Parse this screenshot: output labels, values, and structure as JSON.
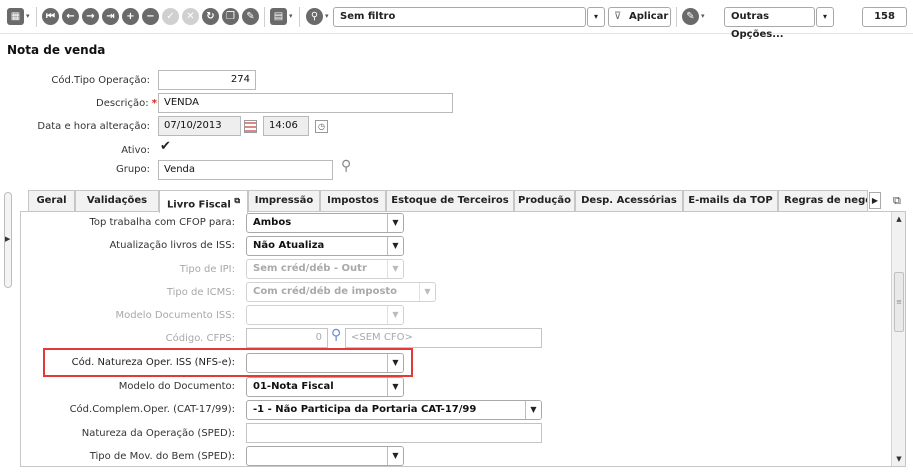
{
  "toolbar": {
    "filter_value": "Sem filtro",
    "apply_label": "Aplicar",
    "more_options_label": "Outras Opções...",
    "count": "158"
  },
  "header": {
    "title": "Nota de venda",
    "cod_tipo_label": "Cód.Tipo Operação:",
    "cod_tipo_value": "274",
    "descricao_label": "Descrição:",
    "descricao_required": "*",
    "descricao_value": "VENDA",
    "data_label": "Data e hora alteração:",
    "data_value": "07/10/2013",
    "hora_value": "14:06",
    "ativo_label": "Ativo:",
    "grupo_label": "Grupo:",
    "grupo_value": "Venda"
  },
  "tabs": [
    {
      "label": "Geral"
    },
    {
      "label": "Validações"
    },
    {
      "label": "Livro Fiscal"
    },
    {
      "label": "Impressão"
    },
    {
      "label": "Impostos"
    },
    {
      "label": "Estoque de Terceiros"
    },
    {
      "label": "Produção"
    },
    {
      "label": "Desp. Acessórias"
    },
    {
      "label": "E-mails da TOP"
    },
    {
      "label": "Regras de negócio"
    }
  ],
  "fields": {
    "cfop_label": "Top trabalha com CFOP para:",
    "cfop_value": "Ambos",
    "iss_label": "Atualização livros de ISS:",
    "iss_value": "Não Atualiza",
    "ipi_label": "Tipo de IPI:",
    "ipi_value": "Sem créd/déb - Outr",
    "icms_label": "Tipo de ICMS:",
    "icms_value": "Com créd/déb de imposto",
    "modelo_iss_label": "Modelo Documento ISS:",
    "cfps_label": "Código. CFPS:",
    "cfps_value": "0",
    "cfps_desc": "<SEM CFO>",
    "natureza_iss_label": "Cód. Natureza Oper. ISS (NFS-e):",
    "modelo_doc_label": "Modelo do Documento:",
    "modelo_doc_value": "01-Nota Fiscal",
    "complem_label": "Cód.Complem.Oper. (CAT-17/99):",
    "complem_value": "-1 - Não Participa da Portaria CAT-17/99",
    "natureza_sped_label": "Natureza da Operação (SPED):",
    "mov_bem_label": "Tipo de Mov. do Bem (SPED):"
  },
  "colors": {
    "highlight": "#e53935",
    "required": "#dd2222"
  }
}
